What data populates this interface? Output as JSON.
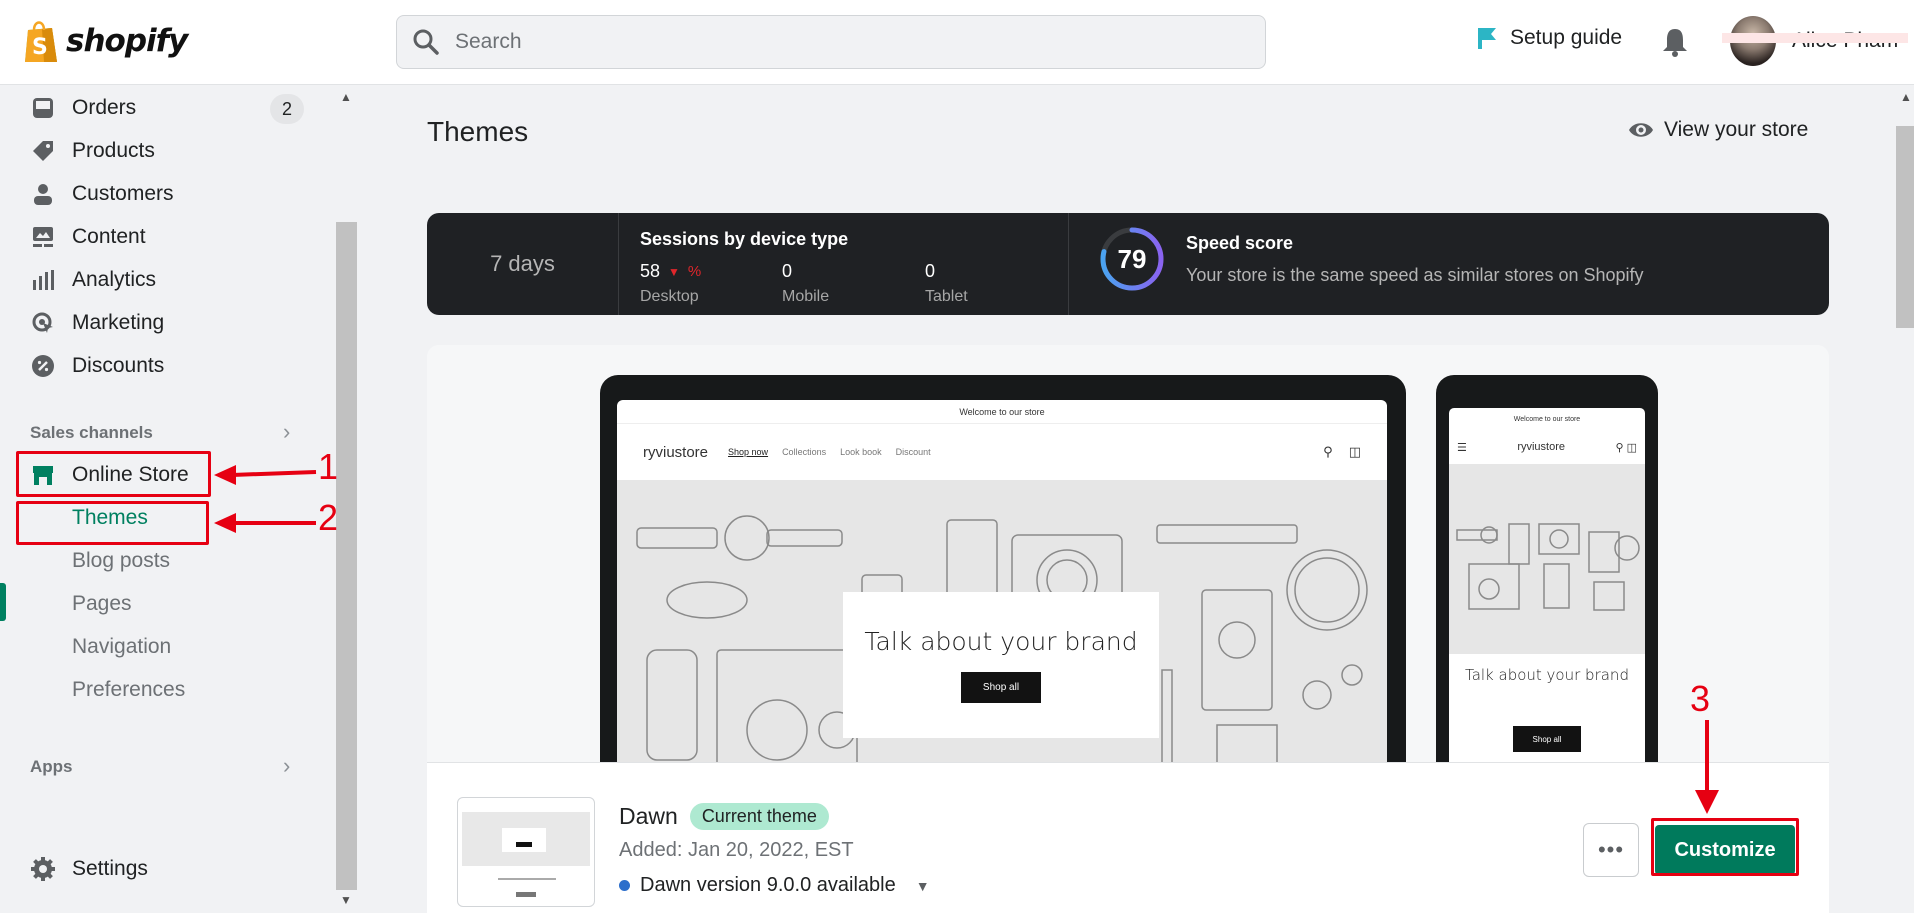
{
  "topbar": {
    "logo_text": "shopify",
    "search_placeholder": "Search",
    "setup_guide": "Setup guide",
    "user_name": "Alice Pham"
  },
  "sidebar": {
    "items": [
      {
        "label": "Orders",
        "icon": "inbox-icon",
        "badge": "2"
      },
      {
        "label": "Products",
        "icon": "tag-icon"
      },
      {
        "label": "Customers",
        "icon": "person-icon"
      },
      {
        "label": "Content",
        "icon": "image-icon"
      },
      {
        "label": "Analytics",
        "icon": "bar-chart-icon"
      },
      {
        "label": "Marketing",
        "icon": "target-icon"
      },
      {
        "label": "Discounts",
        "icon": "discount-icon"
      }
    ],
    "sales_channels_label": "Sales channels",
    "online_store": "Online Store",
    "sub_items": [
      "Themes",
      "Blog posts",
      "Pages",
      "Navigation",
      "Preferences"
    ],
    "active_sub": "Themes",
    "apps_label": "Apps",
    "settings": "Settings"
  },
  "annotations": [
    "1",
    "2",
    "3"
  ],
  "main": {
    "title": "Themes",
    "view_store": "View your store",
    "stats": {
      "period": "7 days",
      "sessions_title": "Sessions by device type",
      "desktop_value": "58",
      "desktop_change": "%",
      "desktop_label": "Desktop",
      "mobile_value": "0",
      "mobile_label": "Mobile",
      "tablet_value": "0",
      "tablet_label": "Tablet",
      "speed_score": "79",
      "speed_score_fraction": 0.79,
      "speed_title": "Speed score",
      "speed_desc": "Your store is the same speed as similar stores on Shopify"
    },
    "preview": {
      "announcement": "Welcome to our store",
      "store_name": "ryviustore",
      "nav": [
        "Shop now",
        "Collections",
        "Look book",
        "Discount"
      ],
      "hero_title": "Talk about your brand",
      "hero_button": "Shop all"
    },
    "theme": {
      "name": "Dawn",
      "badge": "Current theme",
      "added": "Added: Jan 20, 2022, EST",
      "version": "Dawn version 9.0.0 available",
      "more_label": "•••",
      "customize": "Customize"
    }
  },
  "colors": {
    "brand_green": "#008060",
    "customize_bg": "#007a5c",
    "annotation_red": "#e60012",
    "badge_bg": "#aee9d1"
  }
}
